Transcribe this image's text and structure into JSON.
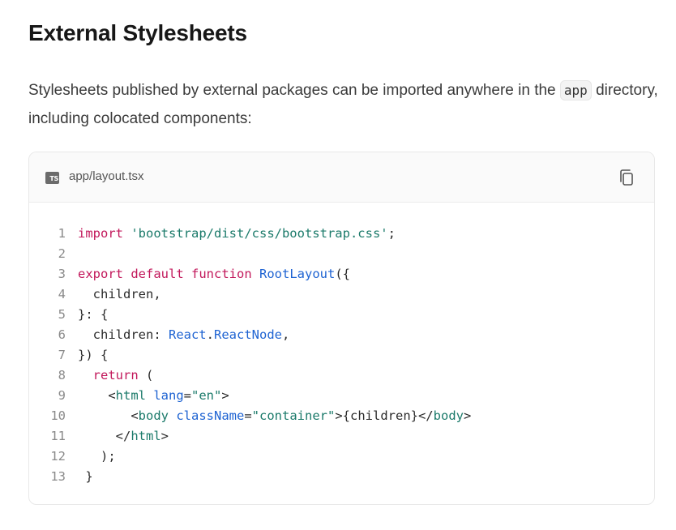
{
  "section": {
    "heading": "External Stylesheets",
    "paragraph_before": "Stylesheets published by external packages can be imported anywhere in the ",
    "inline_code": "app",
    "paragraph_after": " directory, including colocated components:"
  },
  "code_block": {
    "language_badge": "TS",
    "filename": "app/layout.tsx",
    "copy_icon": "copy-icon",
    "line_numbers": [
      "1",
      "2",
      "3",
      "4",
      "5",
      "6",
      "7",
      "8",
      "9",
      "10",
      "11",
      "12",
      "13"
    ],
    "lines": [
      [
        {
          "t": "import",
          "c": "kw"
        },
        {
          "t": " "
        },
        {
          "t": "'bootstrap/dist/css/bootstrap.css'",
          "c": "str"
        },
        {
          "t": ";"
        }
      ],
      [],
      [
        {
          "t": "export",
          "c": "kw"
        },
        {
          "t": " "
        },
        {
          "t": "default",
          "c": "kw"
        },
        {
          "t": " "
        },
        {
          "t": "function",
          "c": "kw"
        },
        {
          "t": " "
        },
        {
          "t": "RootLayout",
          "c": "fn"
        },
        {
          "t": "({"
        }
      ],
      [
        {
          "t": "  children,"
        }
      ],
      [
        {
          "t": "}: {"
        }
      ],
      [
        {
          "t": "  children: "
        },
        {
          "t": "React",
          "c": "fn"
        },
        {
          "t": "."
        },
        {
          "t": "ReactNode",
          "c": "fn"
        },
        {
          "t": ","
        }
      ],
      [
        {
          "t": "}) {"
        }
      ],
      [
        {
          "t": "  "
        },
        {
          "t": "return",
          "c": "kw"
        },
        {
          "t": " ("
        }
      ],
      [
        {
          "t": "    <"
        },
        {
          "t": "html",
          "c": "tag"
        },
        {
          "t": " "
        },
        {
          "t": "lang",
          "c": "attr"
        },
        {
          "t": "="
        },
        {
          "t": "\"en\"",
          "c": "str"
        },
        {
          "t": ">"
        }
      ],
      [
        {
          "t": "       <"
        },
        {
          "t": "body",
          "c": "tag"
        },
        {
          "t": " "
        },
        {
          "t": "className",
          "c": "attr"
        },
        {
          "t": "="
        },
        {
          "t": "\"container\"",
          "c": "str"
        },
        {
          "t": ">{children}</"
        },
        {
          "t": "body",
          "c": "tag"
        },
        {
          "t": ">"
        }
      ],
      [
        {
          "t": "     </"
        },
        {
          "t": "html",
          "c": "tag"
        },
        {
          "t": ">"
        }
      ],
      [
        {
          "t": "   );"
        }
      ],
      [
        {
          "t": " }"
        }
      ]
    ]
  }
}
